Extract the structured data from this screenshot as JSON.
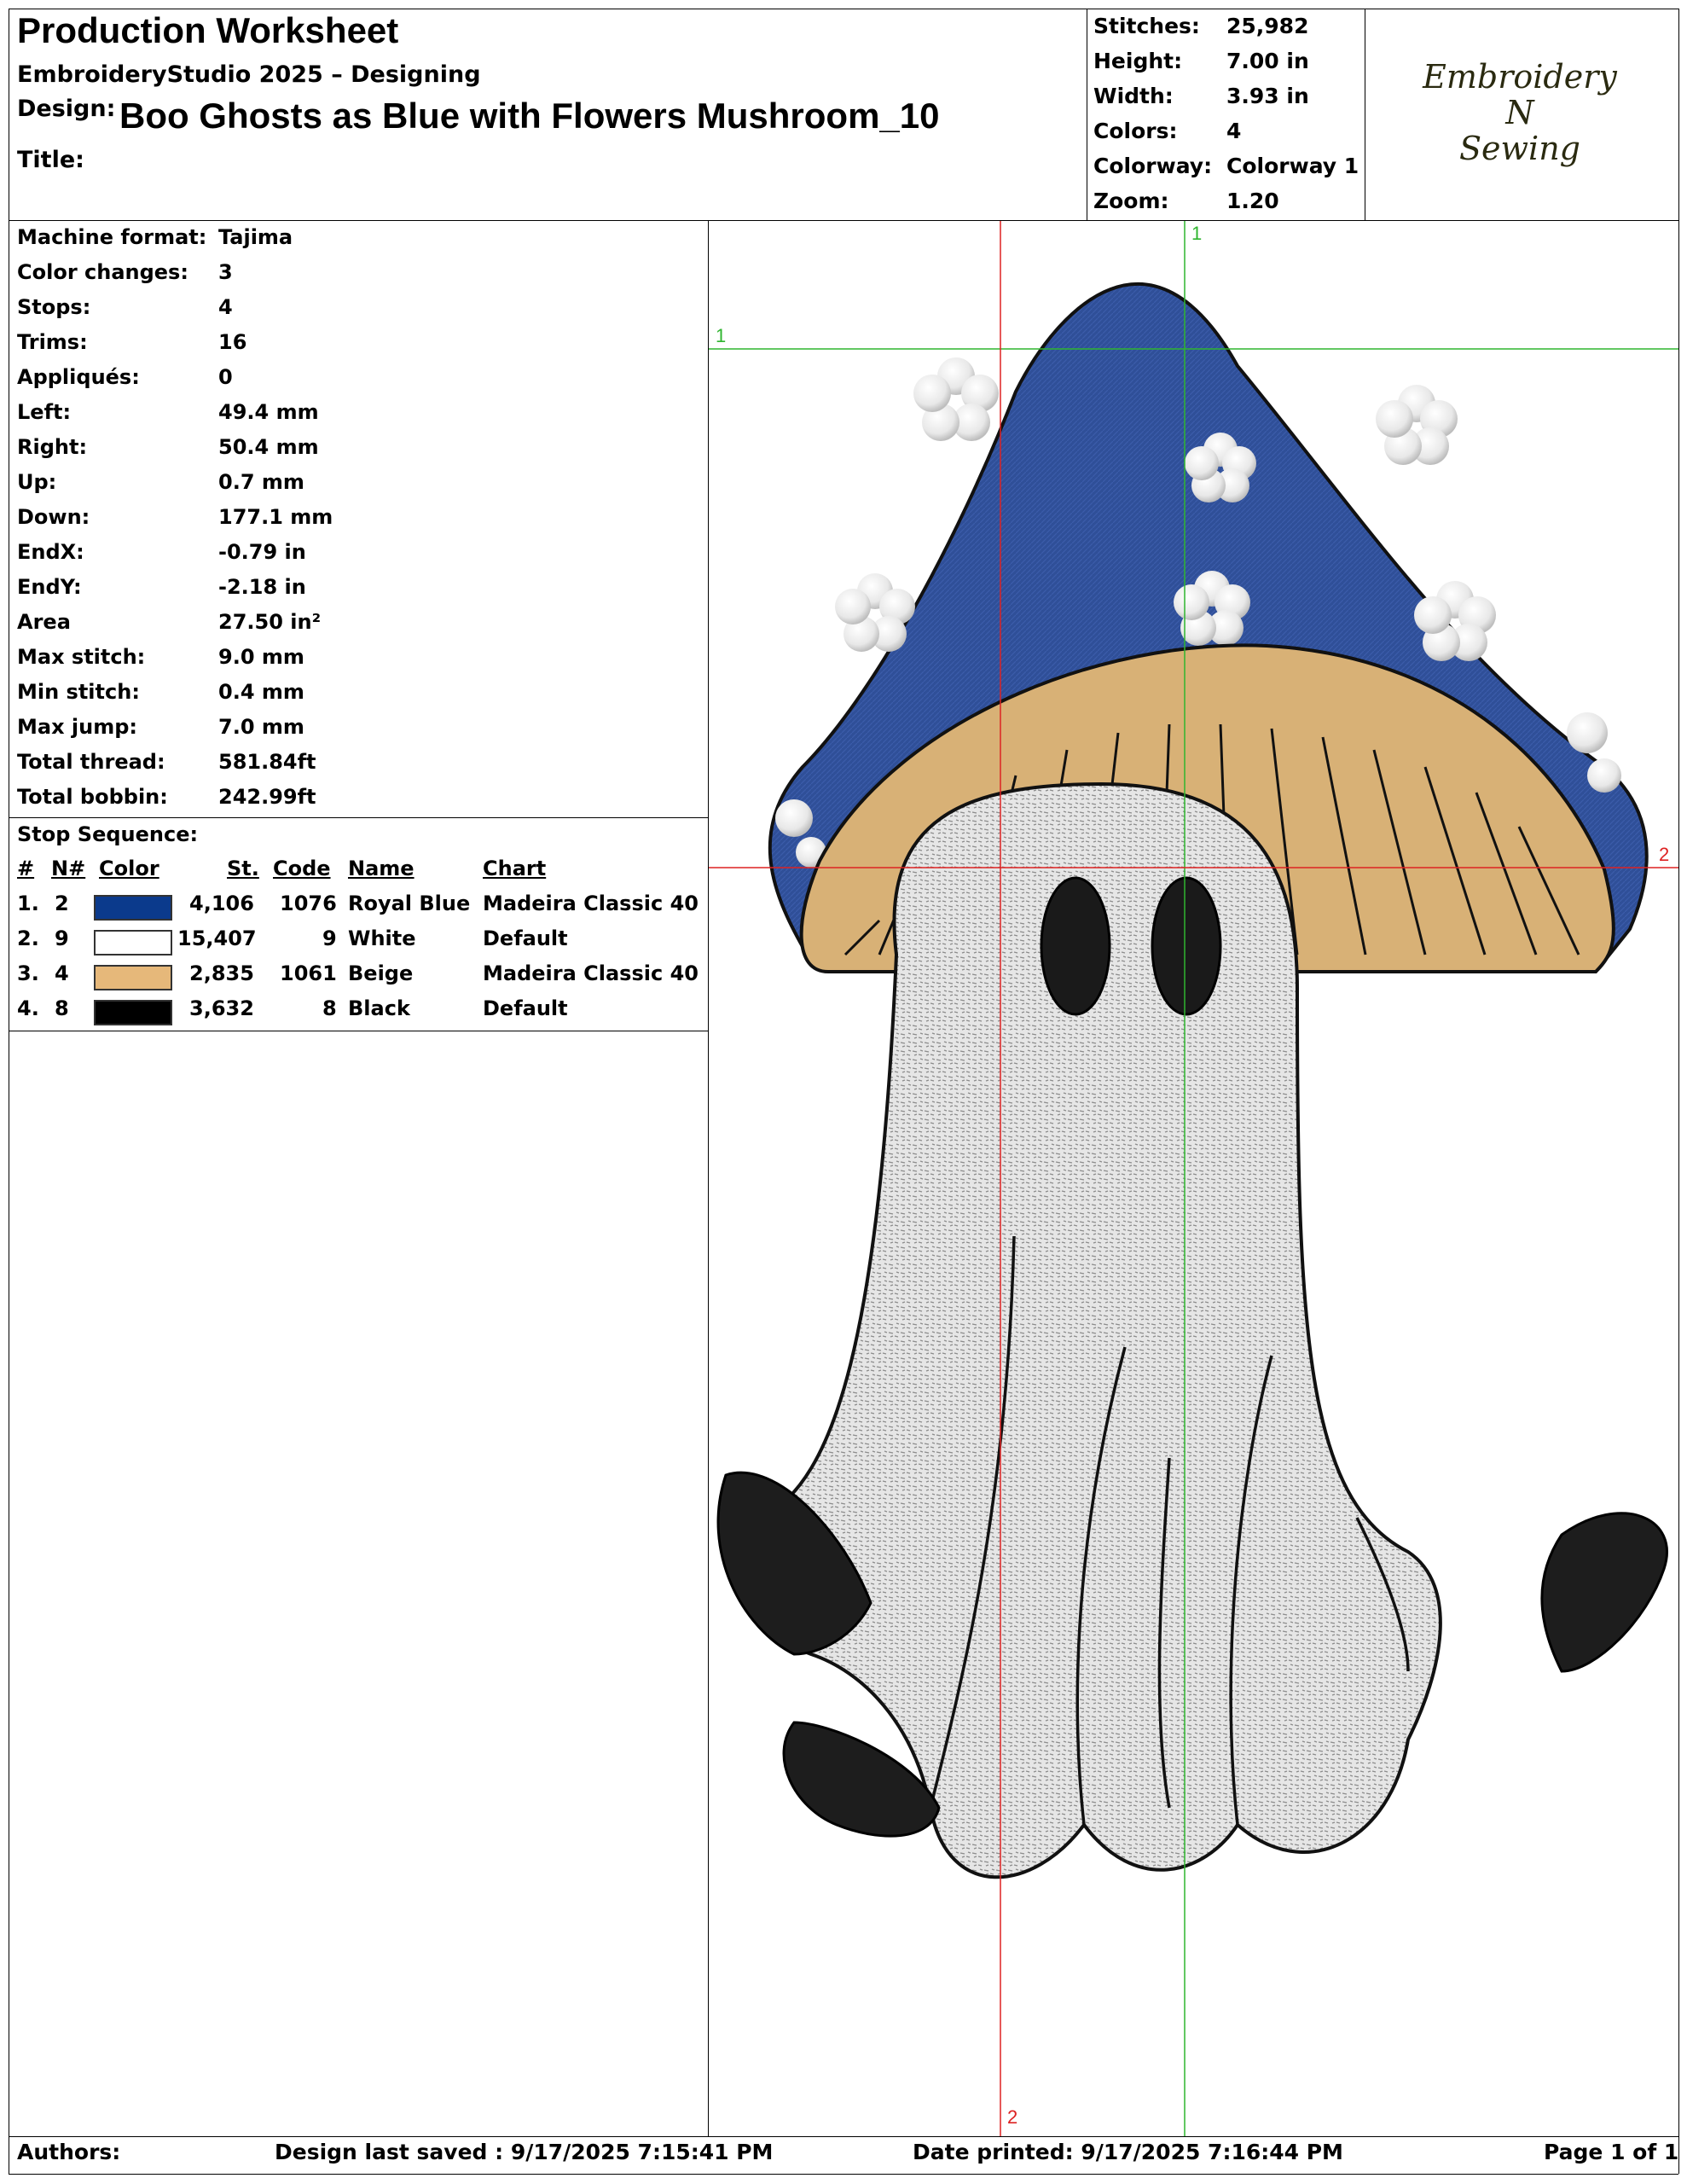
{
  "header": {
    "title": "Production Worksheet",
    "software": "EmbroideryStudio 2025 – Designing",
    "design_label": "Design:",
    "design_name": "Boo Ghosts as Blue with Flowers Mushroom_10",
    "title_label": "Title:"
  },
  "summary": [
    {
      "label": "Stitches:",
      "value": "25,982"
    },
    {
      "label": "Height:",
      "value": "7.00 in"
    },
    {
      "label": "Width:",
      "value": "3.93 in"
    },
    {
      "label": "Colors:",
      "value": "4"
    },
    {
      "label": "Colorway:",
      "value": "Colorway 1"
    },
    {
      "label": "Zoom:",
      "value": "1.20"
    }
  ],
  "logo": {
    "line1": "Embroidery",
    "line2": "N",
    "line3": "Sewing"
  },
  "specs": [
    {
      "label": "Machine format:",
      "value": "Tajima"
    },
    {
      "label": "Color changes:",
      "value": "3"
    },
    {
      "label": "Stops:",
      "value": "4"
    },
    {
      "label": "Trims:",
      "value": "16"
    },
    {
      "label": "Appliqués:",
      "value": "0"
    },
    {
      "label": "Left:",
      "value": "49.4 mm"
    },
    {
      "label": "Right:",
      "value": "50.4 mm"
    },
    {
      "label": "Up:",
      "value": "0.7 mm"
    },
    {
      "label": "Down:",
      "value": "177.1 mm"
    },
    {
      "label": "EndX:",
      "value": "-0.79 in"
    },
    {
      "label": "EndY:",
      "value": "-2.18 in"
    },
    {
      "label": "Area",
      "value": " 27.50 in²"
    },
    {
      "label": "Max stitch:",
      "value": "9.0 mm"
    },
    {
      "label": "Min stitch:",
      "value": "0.4 mm"
    },
    {
      "label": "Max jump:",
      "value": "7.0 mm"
    },
    {
      "label": "Total thread:",
      "value": "581.84ft"
    },
    {
      "label": "Total bobbin:",
      "value": "242.99ft"
    }
  ],
  "stop_sequence": {
    "title": "Stop Sequence:",
    "headers": {
      "num": "#",
      "n": "N#",
      "color": "Color",
      "st": "St.",
      "code": "Code",
      "name": "Name",
      "chart": "Chart"
    },
    "rows": [
      {
        "num": "1.",
        "n": "2",
        "hex": "#0b3a8c",
        "st": "4,106",
        "code": "1076",
        "name": "Royal Blue",
        "chart": "Madeira Classic 40"
      },
      {
        "num": "2.",
        "n": "9",
        "hex": "#ffffff",
        "st": "15,407",
        "code": "9",
        "name": "White",
        "chart": "Default"
      },
      {
        "num": "3.",
        "n": "4",
        "hex": "#e6b87a",
        "st": "2,835",
        "code": "1061",
        "name": "Beige",
        "chart": "Madeira Classic 40"
      },
      {
        "num": "4.",
        "n": "8",
        "hex": "#000000",
        "st": "3,632",
        "code": "8",
        "name": "Black",
        "chart": "Default"
      }
    ]
  },
  "guides": {
    "v1": "1",
    "h1": "1",
    "h2": "2",
    "v2": "2"
  },
  "footer": {
    "authors": "Authors:",
    "saved": "Design last saved : 9/17/2025 7:15:41 PM",
    "printed": "Date printed: 9/17/2025 7:16:44 PM",
    "page": "Page 1 of 1"
  }
}
